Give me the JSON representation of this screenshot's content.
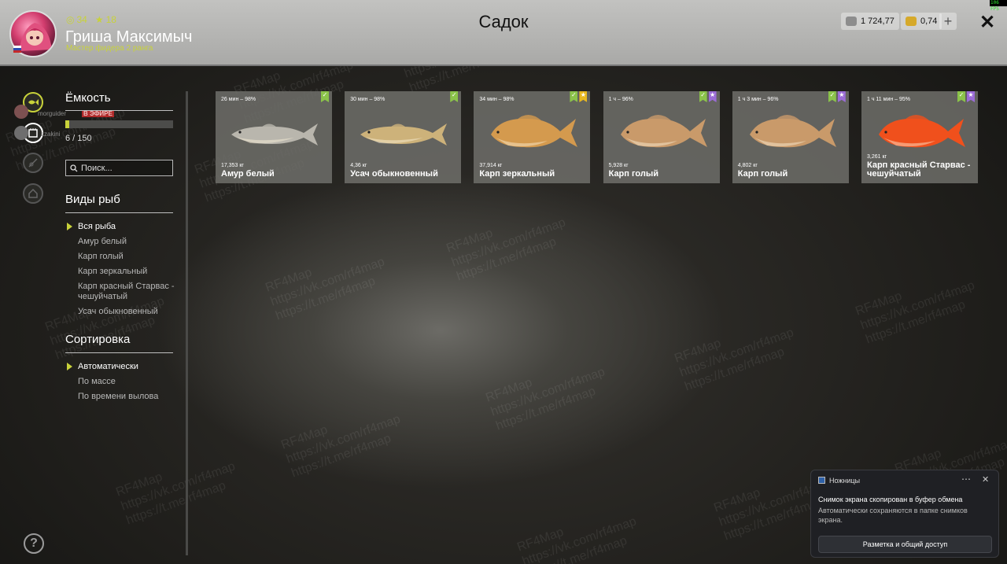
{
  "header": {
    "player_name": "Гриша Максимыч",
    "player_rank": "Мастер фидера 2 ранга",
    "level": "34",
    "stars": "18",
    "title": "Садок",
    "silver": "1 724,77",
    "gold": "0,74",
    "fps": "106 FPS"
  },
  "sidebar": {
    "capacity_heading": "Ёмкость",
    "capacity_text": "6 / 150",
    "capacity_fraction": 0.04,
    "search_placeholder": "Поиск...",
    "species_heading": "Виды рыб",
    "species": [
      {
        "label": "Вся рыба",
        "active": true
      },
      {
        "label": "Амур белый",
        "active": false
      },
      {
        "label": "Карп голый",
        "active": false
      },
      {
        "label": "Карп зеркальный",
        "active": false
      },
      {
        "label": "Карп красный Старвас - чешуйчатый",
        "active": false
      },
      {
        "label": "Усач обыкновенный",
        "active": false
      }
    ],
    "sort_heading": "Сортировка",
    "sort_options": [
      {
        "label": "Автоматически",
        "active": true
      },
      {
        "label": "По массе",
        "active": false
      },
      {
        "label": "По времени вылова",
        "active": false
      }
    ]
  },
  "overlay": {
    "user1": "morguider",
    "badge": "В ЭФИРЕ",
    "user2": "zzakini"
  },
  "fish_cards": [
    {
      "time": "26 мин – 98%",
      "weight": "17,353 кг",
      "name": "Амур белый",
      "badges": [
        "green"
      ],
      "color": "#b9b6ad",
      "body": "long"
    },
    {
      "time": "30 мин – 98%",
      "weight": "4,36 кг",
      "name": "Усач обыкновенный",
      "badges": [
        "green"
      ],
      "color": "#cdb27a",
      "body": "long"
    },
    {
      "time": "34 мин – 98%",
      "weight": "37,914 кг",
      "name": "Карп зеркальный",
      "badges": [
        "green",
        "yellow"
      ],
      "color": "#d49a4e",
      "body": "deep"
    },
    {
      "time": "1 ч – 96%",
      "weight": "5,928 кг",
      "name": "Карп голый",
      "badges": [
        "green",
        "purple"
      ],
      "color": "#c99a6a",
      "body": "deep"
    },
    {
      "time": "1 ч 3 мин – 96%",
      "weight": "4,802 кг",
      "name": "Карп голый",
      "badges": [
        "green",
        "purple"
      ],
      "color": "#c99a6a",
      "body": "deep"
    },
    {
      "time": "1 ч 11 мин – 95%",
      "weight": "3,261 кг",
      "name": "Карп красный Старвас - чешуйчатый",
      "badges": [
        "green",
        "purple"
      ],
      "color": "#f0501c",
      "body": "deep"
    }
  ],
  "toast": {
    "app": "Ножницы",
    "title": "Снимок экрана скопирован в буфер обмена",
    "body": "Автоматически сохраняются в папке снимков экрана.",
    "button": "Разметка и общий доступ"
  },
  "watermark": {
    "brand": "RF4Map",
    "vk": "https://vk.com/rf4map",
    "tg": "https://t.me/rf4map"
  },
  "colors": {
    "accent": "#c8d23a",
    "badge_green": "#8bc34a",
    "badge_yellow": "#e8b820",
    "badge_purple": "#9b6cd6"
  },
  "icons": {
    "nav": [
      "fish-icon",
      "keepnet-icon",
      "rod-icon",
      "home-icon"
    ],
    "help": "help-icon",
    "close": "close-icon"
  }
}
